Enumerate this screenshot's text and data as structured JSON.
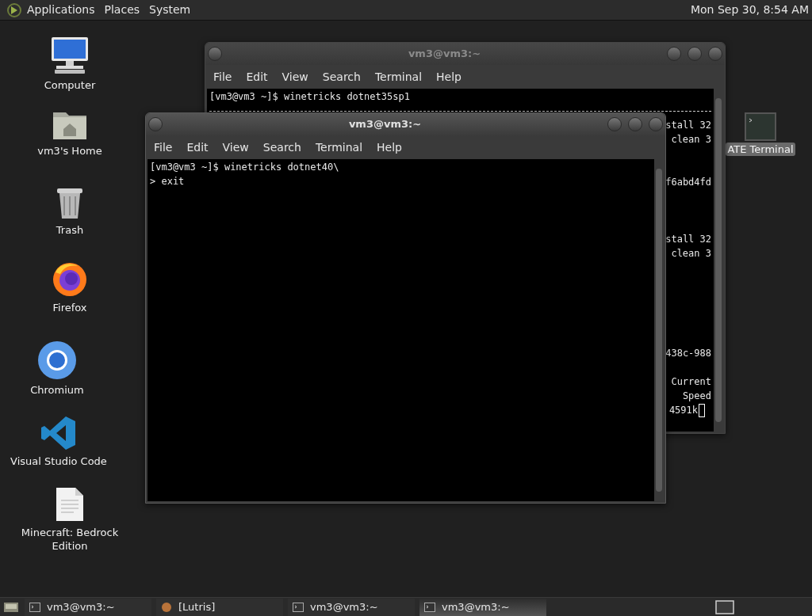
{
  "top_panel": {
    "menus": [
      "Applications",
      "Places",
      "System"
    ],
    "clock": "Mon Sep 30, 8:54 AM"
  },
  "desktop_icons": [
    {
      "label": "Computer",
      "kind": "computer"
    },
    {
      "label": "vm3's Home",
      "kind": "home"
    },
    {
      "label": "Trash",
      "kind": "trash"
    },
    {
      "label": "Firefox",
      "kind": "firefox"
    },
    {
      "label": "Chromium",
      "kind": "chromium"
    },
    {
      "label": "Visual Studio Code",
      "kind": "vscode"
    },
    {
      "label": "Minecraft: Bedrock Edition",
      "kind": "file"
    }
  ],
  "desktop_launcher": {
    "label": "ATE Terminal",
    "selected": true
  },
  "windows": [
    {
      "title": "vm3@vm3:~",
      "active": false,
      "menu": [
        "File",
        "Edit",
        "View",
        "Search",
        "Terminal",
        "Help"
      ],
      "lines": [
        {
          "kind": "text",
          "text": "[vm3@vm3 ~]$ winetricks dotnet35sp1"
        },
        {
          "kind": "rule"
        },
        {
          "kind": "tail",
          "text": "stall 32"
        },
        {
          "kind": "tail",
          "text": "clean 3"
        },
        {
          "kind": "blank"
        },
        {
          "kind": "blank"
        },
        {
          "kind": "tail",
          "text": "f6abd4fd"
        },
        {
          "kind": "blank"
        },
        {
          "kind": "blank"
        },
        {
          "kind": "blank"
        },
        {
          "kind": "tail",
          "text": "stall 32"
        },
        {
          "kind": "tail",
          "text": "clean 3"
        },
        {
          "kind": "blank"
        },
        {
          "kind": "blank"
        },
        {
          "kind": "blank"
        },
        {
          "kind": "blank"
        },
        {
          "kind": "blank"
        },
        {
          "kind": "blank"
        },
        {
          "kind": "tail",
          "text": "438c-988"
        },
        {
          "kind": "blank"
        },
        {
          "kind": "tail",
          "text": "Current"
        },
        {
          "kind": "tail",
          "text": "Speed"
        },
        {
          "kind": "tail",
          "text": "4591k",
          "cursor": true
        }
      ]
    },
    {
      "title": "vm3@vm3:~",
      "active": true,
      "menu": [
        "File",
        "Edit",
        "View",
        "Search",
        "Terminal",
        "Help"
      ],
      "lines": [
        {
          "kind": "text",
          "text": "[vm3@vm3 ~]$ winetricks dotnet40\\"
        },
        {
          "kind": "text",
          "text": "> exit"
        }
      ]
    }
  ],
  "taskbar": {
    "items": [
      {
        "label": "vm3@vm3:~",
        "kind": "terminal",
        "selected": false
      },
      {
        "label": "[Lutris]",
        "kind": "lutris",
        "selected": false
      },
      {
        "label": "vm3@vm3:~",
        "kind": "terminal",
        "selected": false
      },
      {
        "label": "vm3@vm3:~",
        "kind": "terminal",
        "selected": true
      }
    ]
  }
}
